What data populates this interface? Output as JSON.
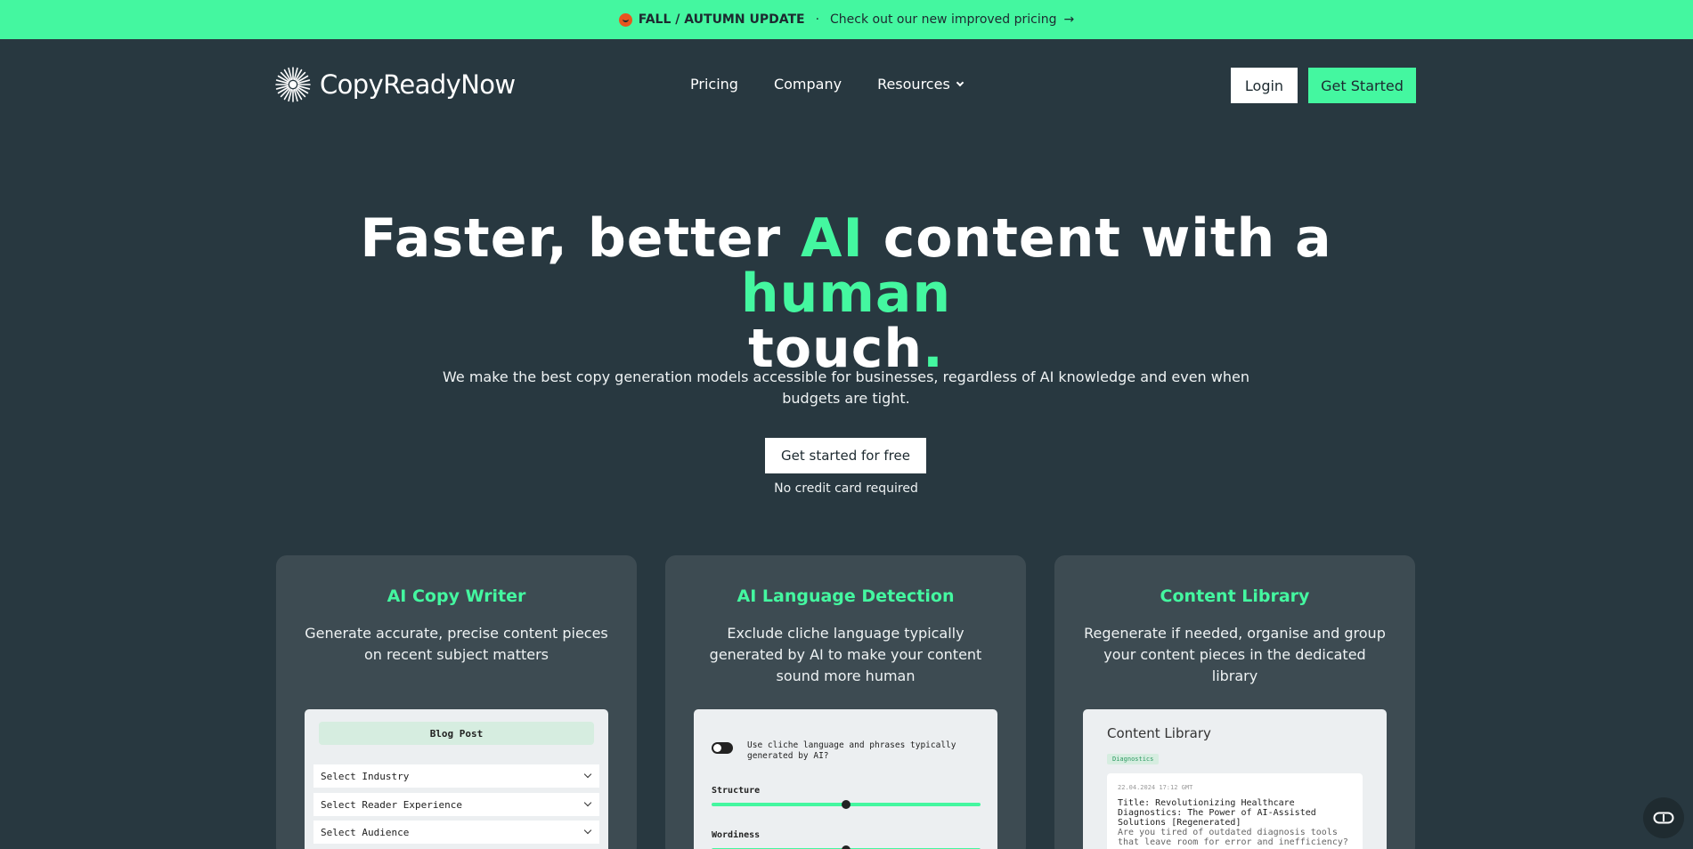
{
  "banner": {
    "tag": "FALL / AUTUMN UPDATE",
    "separator": "·",
    "message": "Check out our new improved pricing",
    "arrow": "→"
  },
  "header": {
    "brand": "CopyReadyNow",
    "nav": [
      "Pricing",
      "Company",
      "Resources"
    ],
    "login_label": "Login",
    "get_started_label": "Get Started"
  },
  "hero": {
    "title_1": "Faster, better ",
    "title_ai": "AI",
    "title_2": " content with a ",
    "title_human": "human",
    "title_3": "touch",
    "title_dot": ".",
    "subtitle": "We make the best copy generation models accessible for businesses, regardless of AI knowledge and even when budgets are tight.",
    "cta_label": "Get started for free",
    "cta_note": "No credit card required"
  },
  "cards": [
    {
      "title": "AI Copy Writer",
      "description": "Generate accurate, precise content pieces on recent subject matters",
      "panel": {
        "header": "Blog Post",
        "selects": [
          "Select Industry",
          "Select Reader Experience",
          "Select Audience"
        ]
      }
    },
    {
      "title": "AI Language Detection",
      "description": "Exclude cliche language typically generated by AI to make your content sound more human",
      "panel": {
        "toggle_label": "Use cliche language and phrases typically generated by AI?",
        "sliders": [
          {
            "label": "Structure",
            "value": 0.5
          },
          {
            "label": "Wordiness",
            "value": 0.5
          }
        ]
      }
    },
    {
      "title": "Content Library",
      "description": "Regenerate if needed, organise and group your content pieces in the dedicated library",
      "panel": {
        "title": "Content Library",
        "tag": "Diagnostics",
        "item_date": "22.04.2024 17:12 GMT",
        "item_title": "Title: Revolutionizing Healthcare Diagnostics: The Power of AI-Assisted Solutions [Regenerated]",
        "item_body": "Are you tired of outdated diagnosis tools that leave room for error and inefficiency?"
      }
    }
  ],
  "colors": {
    "accent": "#44f7a0",
    "background": "#283840",
    "card": "#3d4b52"
  }
}
